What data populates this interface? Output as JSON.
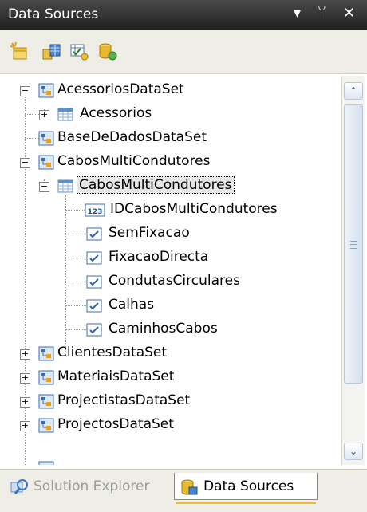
{
  "panel": {
    "title": "Data Sources",
    "dropdown_glyph": "▾",
    "pin_glyph": "ᛘ",
    "close_glyph": "✕"
  },
  "toolbar": {
    "icons": [
      "add-new-data-source-icon",
      "edit-dataset-designer-icon",
      "configure-dataset-icon",
      "refresh-icon"
    ]
  },
  "tree": {
    "nodes": [
      {
        "label": "AcessoriosDataSet",
        "type": "dataset",
        "expander": "−"
      },
      {
        "label": "Acessorios",
        "type": "table",
        "expander": "+"
      },
      {
        "label": "BaseDeDadosDataSet",
        "type": "dataset",
        "expander": ""
      },
      {
        "label": "CabosMultiCondutores",
        "type": "dataset",
        "expander": "−"
      },
      {
        "label": "CabosMultiCondutores",
        "type": "table",
        "expander": "−"
      },
      {
        "label": "IDCabosMultiCondutores",
        "type": "number-field",
        "badge": "123"
      },
      {
        "label": "SemFixacao",
        "type": "bool-field"
      },
      {
        "label": "FixacaoDirecta",
        "type": "bool-field"
      },
      {
        "label": "CondutasCirculares",
        "type": "bool-field"
      },
      {
        "label": "Calhas",
        "type": "bool-field"
      },
      {
        "label": "CaminhosCabos",
        "type": "bool-field"
      },
      {
        "label": "ClientesDataSet",
        "type": "dataset",
        "expander": "+"
      },
      {
        "label": "MateriaisDataSet",
        "type": "dataset",
        "expander": "+"
      },
      {
        "label": "ProjectistasDataSet",
        "type": "dataset",
        "expander": "+"
      },
      {
        "label": "ProjectosDataSet",
        "type": "dataset",
        "expander": "+"
      }
    ]
  },
  "scrollbar": {
    "up_glyph": "⌃",
    "down_glyph": "⌄"
  },
  "tabs": [
    {
      "label": "Solution Explorer",
      "active": false
    },
    {
      "label": "Data Sources",
      "active": true
    }
  ],
  "colors": {
    "titlebar": "#2b2b2b",
    "toolbar": "#efeee6",
    "active_tab_accent": "#f0b838",
    "selection": "#e6e6e6"
  }
}
